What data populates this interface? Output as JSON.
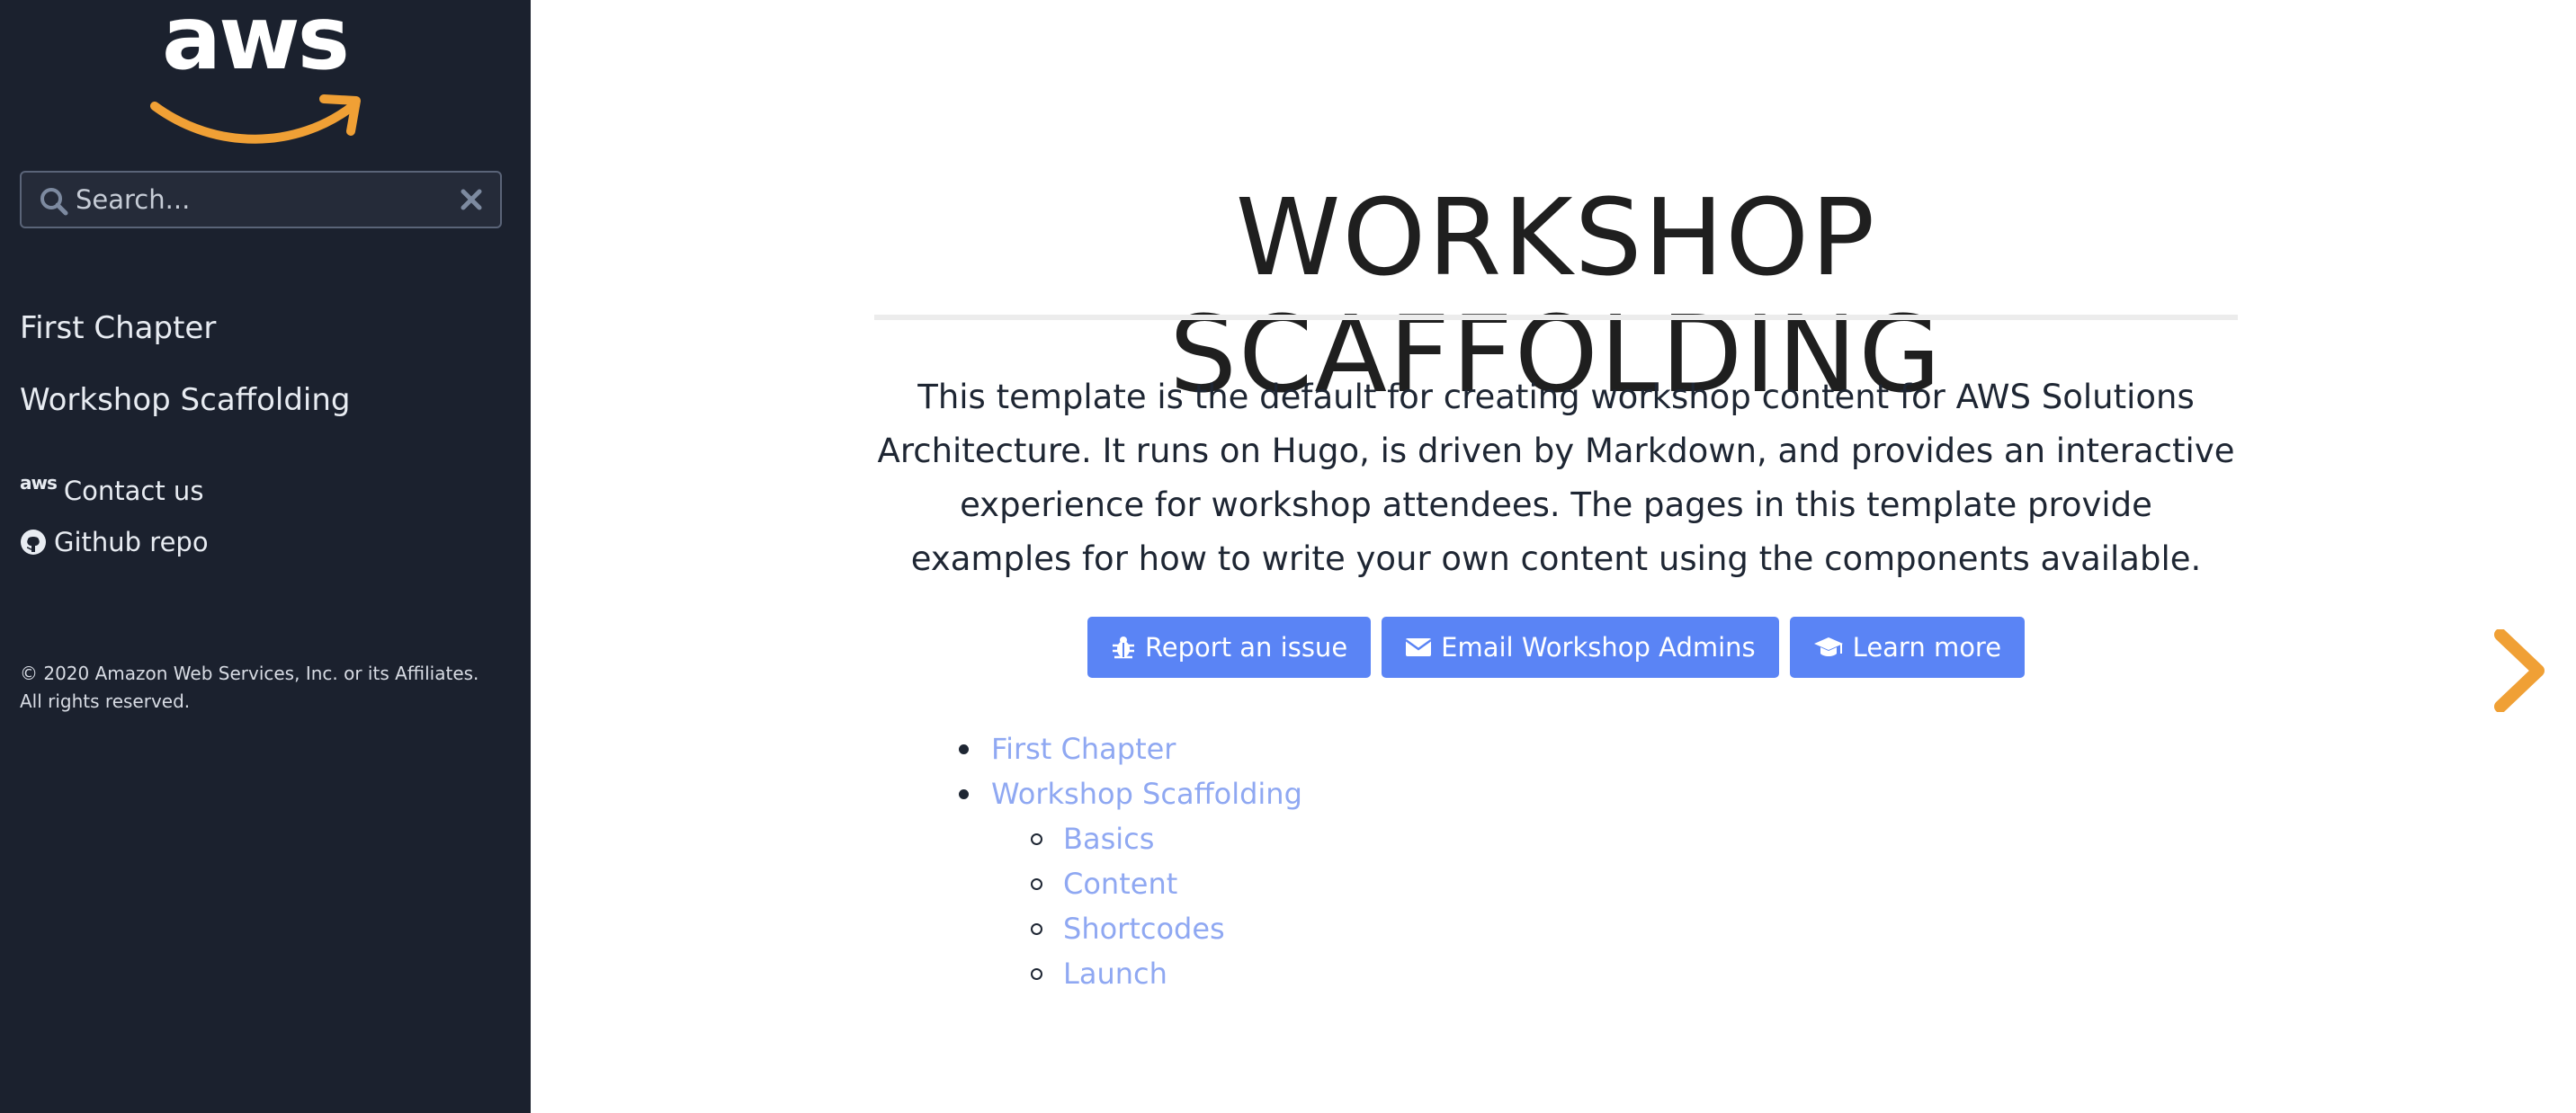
{
  "brand": {
    "logo_text": "aws",
    "accent_color": "#f0a035",
    "sidebar_color": "#1b212e"
  },
  "search": {
    "placeholder": "Search..."
  },
  "sidebar": {
    "items": [
      {
        "label": "First Chapter"
      },
      {
        "label": "Workshop Scaffolding"
      }
    ],
    "shortcuts": [
      {
        "icon": "aws-icon",
        "icon_text": "aws",
        "label": "Contact us"
      },
      {
        "icon": "github-icon",
        "label": "Github repo"
      }
    ],
    "copyright": "© 2020 Amazon Web Services, Inc. or its Affiliates. All rights reserved."
  },
  "main": {
    "title": "WORKSHOP SCAFFOLDING",
    "intro": "This template is the default for creating workshop content for AWS Solutions Architecture. It runs on Hugo, is driven by Markdown, and provides an interactive experience for workshop attendees. The pages in this template provide examples for how to write your own content using the components available.",
    "buttons": [
      {
        "icon": "bug-icon",
        "label": "Report an issue"
      },
      {
        "icon": "envelope-icon",
        "label": "Email Workshop Admins"
      },
      {
        "icon": "graduation-cap-icon",
        "label": "Learn more"
      }
    ],
    "toc": [
      {
        "label": "First Chapter"
      },
      {
        "label": "Workshop Scaffolding",
        "children": [
          {
            "label": "Basics"
          },
          {
            "label": "Content"
          },
          {
            "label": "Shortcodes"
          },
          {
            "label": "Launch"
          }
        ]
      }
    ],
    "button_color": "#5a84f5",
    "link_color": "#8fa8f2"
  },
  "next_nav": {
    "icon": "chevron-right-icon"
  }
}
